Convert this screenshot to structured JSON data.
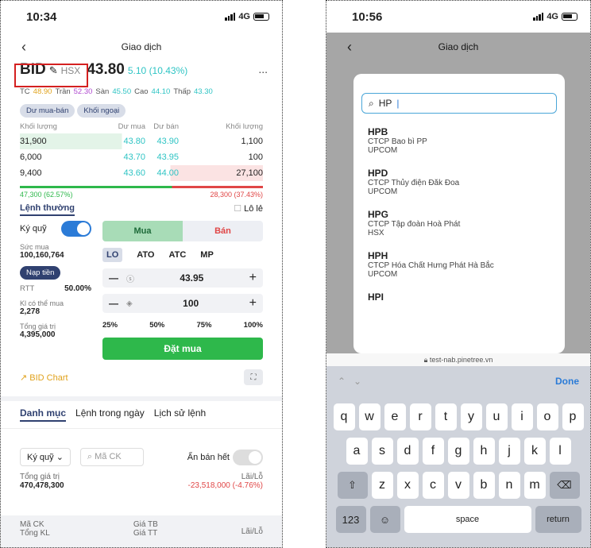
{
  "left": {
    "time": "10:34",
    "network": "4G",
    "title": "Giao dịch",
    "more": "...",
    "ticker": {
      "symbol": "BID",
      "exchange": "HSX",
      "price": "43.80",
      "change": "5.10 (10.43%)"
    },
    "refs": [
      {
        "label": "TC",
        "value": "48.90"
      },
      {
        "label": "Trần",
        "value": "52.30"
      },
      {
        "label": "Sàn",
        "value": "45.50"
      },
      {
        "label": "Cao",
        "value": "44.10"
      },
      {
        "label": "Thấp",
        "value": "43.30"
      }
    ],
    "pills": [
      "Dư mua-bán",
      "Khối ngoại"
    ],
    "ob_headers": [
      "Khối lượng",
      "Dư mua",
      "Dư bán",
      "Khối lượng"
    ],
    "ob_rows": [
      [
        "31,900",
        "43.80",
        "43.90",
        "1,100"
      ],
      [
        "6,000",
        "43.70",
        "43.95",
        "100"
      ],
      [
        "9,400",
        "43.60",
        "44.00",
        "27,100"
      ]
    ],
    "buy_ratio": "47,300 (62.57%)",
    "sell_ratio": "28,300 (37.43%)",
    "buy_fraction": 0.6257,
    "order_tab": "Lệnh thường",
    "odd_lot": "Lô lẻ",
    "margin_label": "Ký quỹ",
    "purchasing_label": "Sức mua",
    "purchasing_value": "100,160,764",
    "deposit": "Nạp tiền",
    "rtt_label": "RTT",
    "rtt_value": "50.00%",
    "buyable_label": "Kl có thể mua",
    "buyable_value": "2,278",
    "total_label": "Tổng giá trị",
    "total_value": "4,395,000",
    "side_buy": "Mua",
    "side_sell": "Bán",
    "order_types": [
      "LO",
      "ATO",
      "ATC",
      "MP"
    ],
    "price_value": "43.95",
    "qty_value": "100",
    "pcts": [
      "25%",
      "50%",
      "75%",
      "100%"
    ],
    "place": "Đặt mua",
    "chart_link": "BID Chart",
    "bottom_tabs": [
      "Danh mục",
      "Lệnh trong ngày",
      "Lịch sử lệnh"
    ],
    "filter_account": "Ký quỹ",
    "filter_search": "Mã CK",
    "hide_sold": "Ẩn bán hết",
    "portfolio_total_label": "Tổng giá trị",
    "portfolio_total": "470,478,300",
    "pl_label": "Lãi/Lỗ",
    "pl_value": "-23,518,000 (-4.76%)",
    "table_cols": [
      "Mã CK",
      "Tổng KL",
      "Giá TB",
      "Giá TT",
      "Lãi/Lỗ"
    ]
  },
  "right": {
    "time": "10:56",
    "network": "4G",
    "title": "Giao dịch",
    "query": "HP",
    "results": [
      {
        "symbol": "HPB",
        "name": "CTCP Bao bì PP",
        "exchange": "UPCOM"
      },
      {
        "symbol": "HPD",
        "name": "CTCP Thủy điện Đăk Đoa",
        "exchange": "UPCOM"
      },
      {
        "symbol": "HPG",
        "name": "CTCP Tập đoàn Hoà Phát",
        "exchange": "HSX"
      },
      {
        "symbol": "HPH",
        "name": "CTCP Hóa Chất Hưng Phát Hà Bắc",
        "exchange": "UPCOM"
      },
      {
        "symbol": "HPI",
        "name": "",
        "exchange": ""
      }
    ],
    "url": "test-nab.pinetree.vn",
    "done": "Done",
    "row1": [
      "q",
      "w",
      "e",
      "r",
      "t",
      "y",
      "u",
      "i",
      "o",
      "p"
    ],
    "row2": [
      "a",
      "s",
      "d",
      "f",
      "g",
      "h",
      "j",
      "k",
      "l"
    ],
    "row3": [
      "z",
      "x",
      "c",
      "v",
      "b",
      "n",
      "m"
    ],
    "numkey": "123",
    "space": "space",
    "return": "return"
  },
  "colors": {
    "accent": "#304170",
    "up": "#2ec4c4",
    "buy": "#2eb84b",
    "sell": "#e04646",
    "highlight": "#d42020"
  }
}
